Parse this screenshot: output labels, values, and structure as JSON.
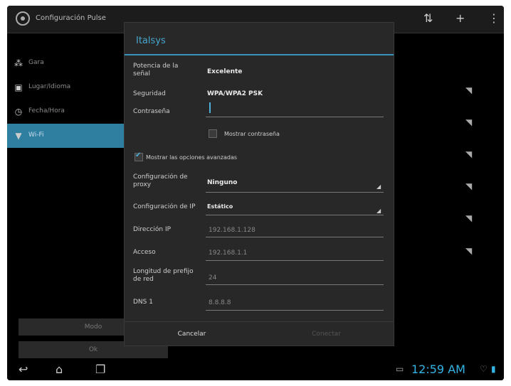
{
  "actionbar": {
    "title": "Configuración Pulse",
    "icons": [
      "settings-app-icon",
      "wifi-scan-icon",
      "add-icon",
      "overflow-menu-icon"
    ]
  },
  "settings_list": [
    {
      "label": "Gara",
      "icon": "group-icon"
    },
    {
      "label": "Lugar/Idioma",
      "icon": "language-icon"
    },
    {
      "label": "Fecha/Hora",
      "icon": "clock-icon"
    },
    {
      "label": "Wi-Fi",
      "icon": "wifi-icon",
      "active": true
    }
  ],
  "bottom_buttons": [
    "Modo",
    "Ok"
  ],
  "dialog": {
    "title": "Italsys",
    "signal_label": "Potencia de la señal",
    "signal_value": "Excelente",
    "security_label": "Seguridad",
    "security_value": "WPA/WPA2 PSK",
    "password_label": "Contraseña",
    "show_password_label": "Mostrar contraseña",
    "advanced_label": "Mostrar las opciones avanzadas",
    "proxy_label": "Configuración de proxy",
    "proxy_value": "Ninguno",
    "ip_config_label": "Configuración de IP",
    "ip_config_value": "Estático",
    "ip_address_label": "Dirección IP",
    "ip_address_value": "192.168.1.128",
    "gateway_label": "Acceso",
    "gateway_value": "192.168.1.1",
    "prefix_label": "Longitud de prefijo de red",
    "prefix_value": "24",
    "dns_label": "DNS 1",
    "dns_value": "8.8.8.8",
    "cancel_label": "Cancelar",
    "connect_label": "Conectar"
  },
  "statusbar": {
    "time": "12:59 AM"
  },
  "colors": {
    "accent": "#33b5e5",
    "selected_item": "#2f7fa1",
    "dialog_bg": "#282828"
  }
}
